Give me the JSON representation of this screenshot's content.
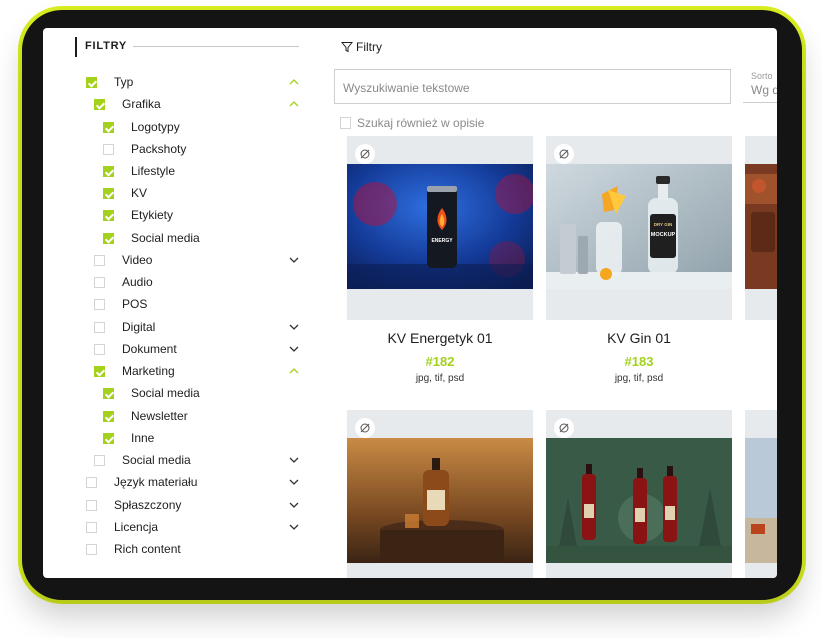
{
  "sidebar": {
    "title": "FILTRY",
    "items": [
      {
        "label": "Typ",
        "checked": true,
        "expanded": true
      },
      {
        "label": "Grafika",
        "checked": true,
        "expanded": true
      },
      {
        "label": "Logotypy",
        "checked": true
      },
      {
        "label": "Packshoty",
        "checked": false
      },
      {
        "label": "Lifestyle",
        "checked": true
      },
      {
        "label": "KV",
        "checked": true
      },
      {
        "label": "Etykiety",
        "checked": true
      },
      {
        "label": "Social media",
        "checked": true
      },
      {
        "label": "Video",
        "checked": false,
        "expanded": false
      },
      {
        "label": "Audio",
        "checked": false
      },
      {
        "label": "POS",
        "checked": false
      },
      {
        "label": "Digital",
        "checked": false,
        "expanded": false
      },
      {
        "label": "Dokument",
        "checked": false,
        "expanded": false
      },
      {
        "label": "Marketing",
        "checked": true,
        "expanded": true
      },
      {
        "label": "Social media",
        "checked": true
      },
      {
        "label": "Newsletter",
        "checked": true
      },
      {
        "label": "Inne",
        "checked": true
      },
      {
        "label": "Social media",
        "checked": false,
        "expanded": false
      },
      {
        "label": "Język materiału",
        "checked": false,
        "expanded": false
      },
      {
        "label": "Spłaszczony",
        "checked": false,
        "expanded": false
      },
      {
        "label": "Licencja",
        "checked": false,
        "expanded": false
      },
      {
        "label": "Rich content",
        "checked": false
      }
    ]
  },
  "toolbar": {
    "filters_label": "Filtry",
    "search_placeholder": "Wyszukiwanie tekstowe",
    "sort_label": "Sorto",
    "sort_value": "Wg d",
    "search_in_description_label": "Szukaj również w opisie"
  },
  "cards": [
    {
      "name": "KV Energetyk 01",
      "number": "#182",
      "formats": "jpg, tif, psd",
      "can_label": "ENERGY"
    },
    {
      "name": "KV Gin 01",
      "number": "#183",
      "formats": "jpg, tif, psd",
      "label_line1": "DRY GIN",
      "label_line2": "MOCKUP"
    },
    {
      "name": "",
      "number": "",
      "formats": ""
    },
    {
      "name": "",
      "number": "",
      "formats": ""
    }
  ],
  "colors": {
    "accent": "#a3d11c",
    "frame": "#141414",
    "glow": "#d9ef1f"
  }
}
